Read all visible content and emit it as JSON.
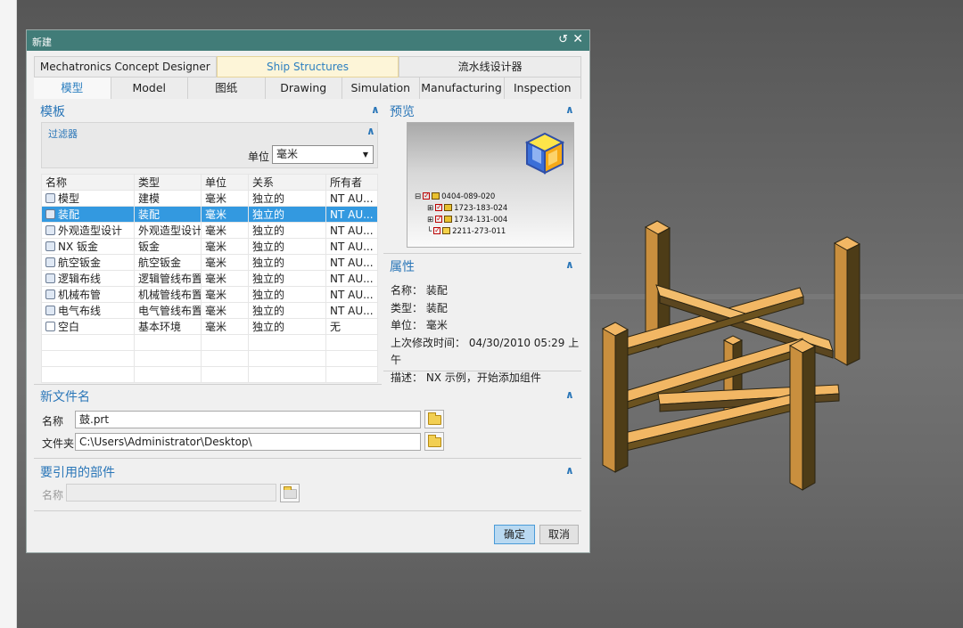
{
  "dialog": {
    "title": "新建",
    "restore_glyph": "↺",
    "close_glyph": "✕",
    "app_tabs": [
      "Mechatronics Concept Designer",
      "Ship Structures",
      "流水线设计器"
    ],
    "active_app_tab": 1,
    "type_tabs": [
      "模型",
      "Model",
      "图纸",
      "Drawing",
      "Simulation",
      "Manufacturing",
      "Inspection"
    ],
    "active_type_tab": 0
  },
  "templates": {
    "title": "模板",
    "filter_label": "过滤器",
    "unit_label": "单位",
    "unit_value": "毫米",
    "columns": [
      "名称",
      "类型",
      "单位",
      "关系",
      "所有者"
    ],
    "rows": [
      [
        "模型",
        "建模",
        "毫米",
        "独立的",
        "NT AU..."
      ],
      [
        "装配",
        "装配",
        "毫米",
        "独立的",
        "NT AU..."
      ],
      [
        "外观造型设计",
        "外观造型设计",
        "毫米",
        "独立的",
        "NT AU..."
      ],
      [
        "NX 钣金",
        "钣金",
        "毫米",
        "独立的",
        "NT AU..."
      ],
      [
        "航空钣金",
        "航空钣金",
        "毫米",
        "独立的",
        "NT AU..."
      ],
      [
        "逻辑布线",
        "逻辑管线布置",
        "毫米",
        "独立的",
        "NT AU..."
      ],
      [
        "机械布管",
        "机械管线布置",
        "毫米",
        "独立的",
        "NT AU..."
      ],
      [
        "电气布线",
        "电气管线布置",
        "毫米",
        "独立的",
        "NT AU..."
      ],
      [
        "空白",
        "基本环境",
        "毫米",
        "独立的",
        "无"
      ]
    ],
    "selected_row": 1
  },
  "preview": {
    "title": "预览",
    "tree": [
      "0404-089-020",
      "1723-183-024",
      "1734-131-004",
      "2211-273-011"
    ]
  },
  "properties": {
    "title": "属性",
    "lines": [
      "名称： 装配",
      "类型： 装配",
      "单位： 毫米",
      "上次修改时间： 04/30/2010 05:29 上午",
      "描述： NX 示例，开始添加组件"
    ]
  },
  "new_file": {
    "title": "新文件名",
    "name_label": "名称",
    "name_value": "鼓.prt",
    "folder_label": "文件夹",
    "folder_value": "C:\\Users\\Administrator\\Desktop\\"
  },
  "ref_part": {
    "title": "要引用的部件",
    "name_label": "名称",
    "name_value": ""
  },
  "buttons": {
    "ok": "确定",
    "cancel": "取消"
  },
  "colors": {
    "titlebar": "#417c78",
    "accent": "#2a76b8",
    "selection": "#3399e0",
    "wood": "#f2b764"
  }
}
